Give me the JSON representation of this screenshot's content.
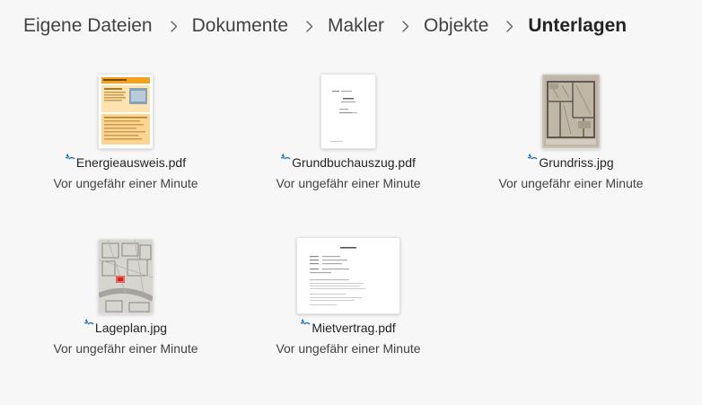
{
  "breadcrumb": [
    {
      "label": "Eigene Dateien"
    },
    {
      "label": "Dokumente"
    },
    {
      "label": "Makler"
    },
    {
      "label": "Objekte"
    },
    {
      "label": "Unterlagen"
    }
  ],
  "files": [
    {
      "name": "Energieausweis.pdf",
      "modified": "Vor ungefähr einer Minute",
      "thumbnail": "energy-certificate-document-thumbnail",
      "status_icon": "sync-pending-icon"
    },
    {
      "name": "Grundbuchauszug.pdf",
      "modified": "Vor ungefähr einer Minute",
      "thumbnail": "land-register-document-thumbnail",
      "status_icon": "sync-pending-icon"
    },
    {
      "name": "Grundriss.jpg",
      "modified": "Vor ungefähr einer Minute",
      "thumbnail": "floor-plan-image-thumbnail",
      "status_icon": "sync-pending-icon"
    },
    {
      "name": "Lageplan.jpg",
      "modified": "Vor ungefähr einer Minute",
      "thumbnail": "site-plan-image-thumbnail",
      "status_icon": "sync-pending-icon"
    },
    {
      "name": "Mietvertrag.pdf",
      "modified": "Vor ungefähr einer Minute",
      "thumbnail": "rental-contract-document-thumbnail",
      "status_icon": "sync-pending-icon"
    }
  ],
  "colors": {
    "sync_icon": "#0f6cbd",
    "energy_accent": "#f4a21e",
    "site_plan_marker": "#d9251c"
  }
}
